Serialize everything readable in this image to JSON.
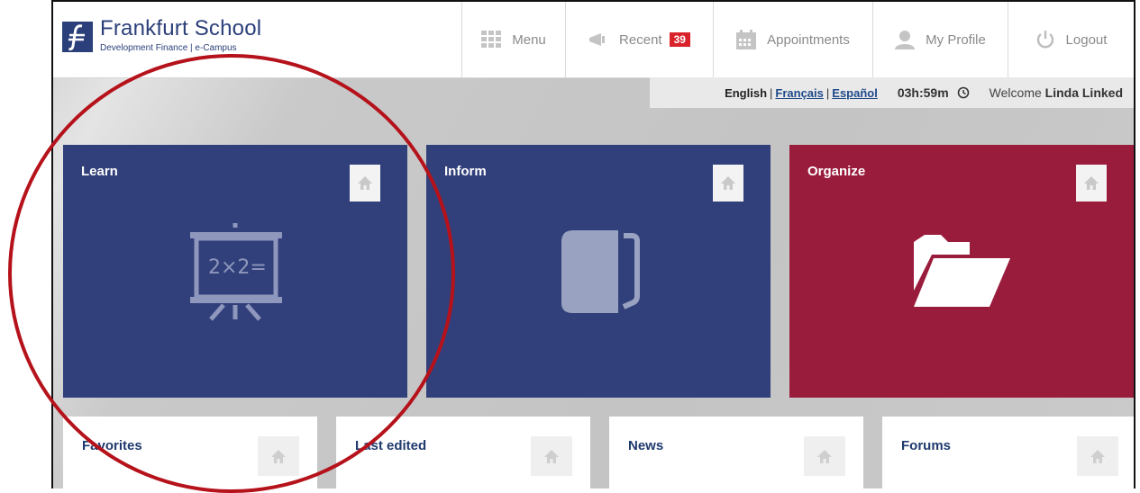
{
  "header": {
    "logo_title": "Frankfurt School",
    "logo_subtitle": "Development Finance | e-Campus",
    "nav": [
      {
        "label": "Menu",
        "icon": "grid-icon"
      },
      {
        "label": "Recent",
        "icon": "megaphone-icon",
        "badge": "39"
      },
      {
        "label": "Appointments",
        "icon": "calendar-icon"
      },
      {
        "label": "My Profile",
        "icon": "user-icon"
      },
      {
        "label": "Logout",
        "icon": "power-icon"
      }
    ]
  },
  "infobar": {
    "languages": [
      "English",
      "Français",
      "Español"
    ],
    "separator": "|",
    "timer": "03h:59m",
    "welcome_prefix": "Welcome",
    "user_name": "Linda Linked"
  },
  "tiles": [
    {
      "title": "Learn",
      "color": "#31407a",
      "icon": "blackboard-icon",
      "board_text": "2×2="
    },
    {
      "title": "Inform",
      "color": "#31407a",
      "icon": "book-icon"
    },
    {
      "title": "Organize",
      "color": "#9a1c3d",
      "icon": "folder-icon"
    }
  ],
  "small_tiles": [
    {
      "title": "Favorites"
    },
    {
      "title": "Last edited"
    },
    {
      "title": "News"
    },
    {
      "title": "Forums"
    }
  ],
  "colors": {
    "brand_blue": "#2b3f7a",
    "tile_blue": "#31407a",
    "tile_red": "#9a1c3d",
    "badge_red": "#d9222a",
    "annotation_red": "#b5121b"
  }
}
